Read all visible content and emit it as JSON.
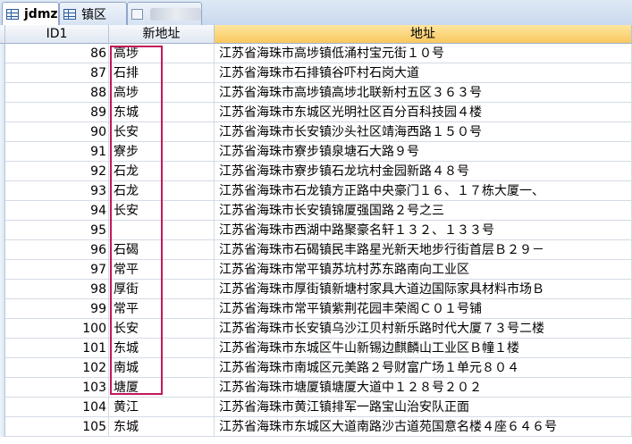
{
  "tabs": [
    {
      "label": "jdmz",
      "icon": "table-icon",
      "active": true
    },
    {
      "label": "镇区",
      "icon": "table-icon",
      "active": false
    },
    {
      "label": "",
      "icon": "query-icon",
      "active": false
    }
  ],
  "columns": {
    "id": "ID1",
    "new_address": "新地址",
    "address": "地址"
  },
  "rows": [
    {
      "id": "86",
      "new": "高埗",
      "addr": "江苏省海珠市高埗镇低涌村宝元街１０号"
    },
    {
      "id": "87",
      "new": "石排",
      "addr": "江苏省海珠市石排镇谷吓村石岗大道"
    },
    {
      "id": "88",
      "new": "高埗",
      "addr": "江苏省海珠市高埗镇高埗北联新村五区３６３号"
    },
    {
      "id": "89",
      "new": "东城",
      "addr": "江苏省海珠市东城区光明社区百分百科技园４楼"
    },
    {
      "id": "90",
      "new": "长安",
      "addr": "江苏省海珠市长安镇沙头社区靖海西路１５０号"
    },
    {
      "id": "91",
      "new": "寮步",
      "addr": "江苏省海珠市寮步镇泉塘石大路９号"
    },
    {
      "id": "92",
      "new": "石龙",
      "addr": "江苏省海珠市寮步镇石龙坑村金园新路４８号"
    },
    {
      "id": "93",
      "new": "石龙",
      "addr": "江苏省海珠市石龙镇方正路中央豪门１６、１７栋大厦一、"
    },
    {
      "id": "94",
      "new": "长安",
      "addr": "江苏省海珠市长安镇锦厦强国路２号之三"
    },
    {
      "id": "95",
      "new": "",
      "addr": "江苏省海珠市西湖中路聚豪名轩１３２、１３３号"
    },
    {
      "id": "96",
      "new": "石碣",
      "addr": "江苏省海珠市石碣镇民丰路星光新天地步行街首层Ｂ２９－"
    },
    {
      "id": "97",
      "new": "常平",
      "addr": "江苏省海珠市常平镇苏坑村苏东路南向工业区"
    },
    {
      "id": "98",
      "new": "厚街",
      "addr": "江苏省海珠市厚街镇新塘村家具大道边国际家具材料市场Ｂ"
    },
    {
      "id": "99",
      "new": "常平",
      "addr": "江苏省海珠市常平镇紫荆花园丰荣阁Ｃ０１号铺"
    },
    {
      "id": "100",
      "new": "长安",
      "addr": "江苏省海珠市长安镇乌沙江贝村新乐路时代大厦７３号二楼"
    },
    {
      "id": "101",
      "new": "东城",
      "addr": "江苏省海珠市东城区牛山新锡边麒麟山工业区Ｂ幢１楼"
    },
    {
      "id": "102",
      "new": "南城",
      "addr": "江苏省海珠市南城区元美路２号财富广场１单元８０４"
    },
    {
      "id": "103",
      "new": "塘厦",
      "addr": "江苏省海珠市塘厦镇塘厦大道中１２８号２０２"
    },
    {
      "id": "104",
      "new": "黄江",
      "addr": "江苏省海珠市黄江镇排军一路宝山治安队正面"
    },
    {
      "id": "105",
      "new": "东城",
      "addr": "江苏省海珠市东城区大道南路沙古道苑国意名楼４座６４６号"
    }
  ]
}
